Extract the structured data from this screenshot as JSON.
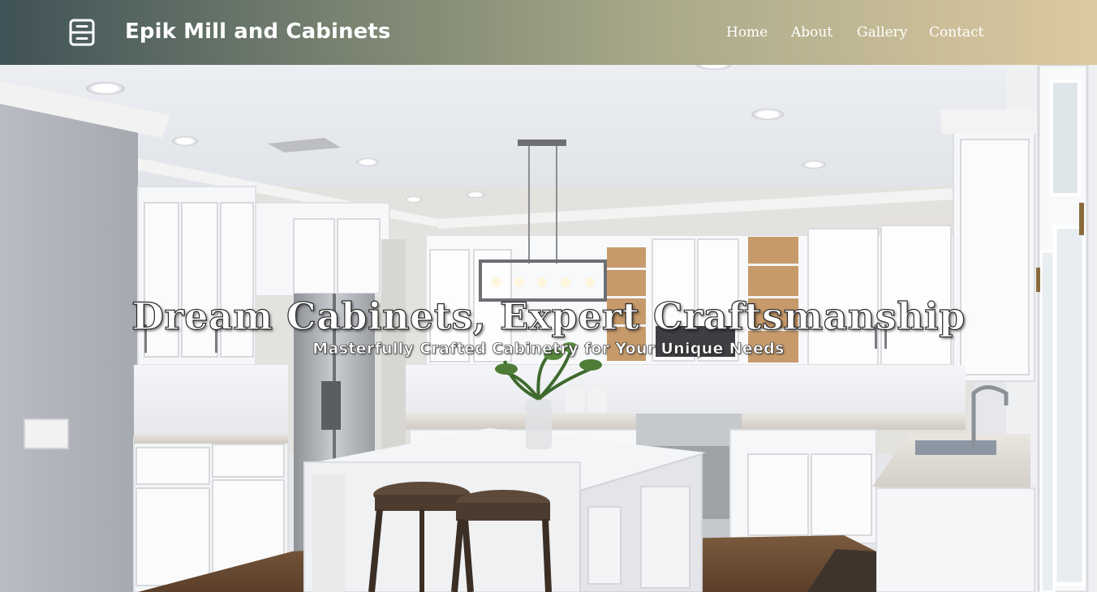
{
  "header": {
    "brand": "Epik Mill and Cabinets",
    "logo_icon": "cabinet-drawers-icon",
    "gradient_colors": [
      "#3f5257",
      "#76816f",
      "#a9a98a",
      "#ddc9a0"
    ]
  },
  "nav": {
    "items": [
      {
        "label": "Home"
      },
      {
        "label": "About"
      },
      {
        "label": "Gallery"
      },
      {
        "label": "Contact"
      }
    ]
  },
  "hero": {
    "title": "Dream Cabinets, Expert Craftsmanship",
    "subtitle": "Masterfully Crafted Cabinetry for Your Unique Needs",
    "image": "white-kitchen-photo"
  }
}
